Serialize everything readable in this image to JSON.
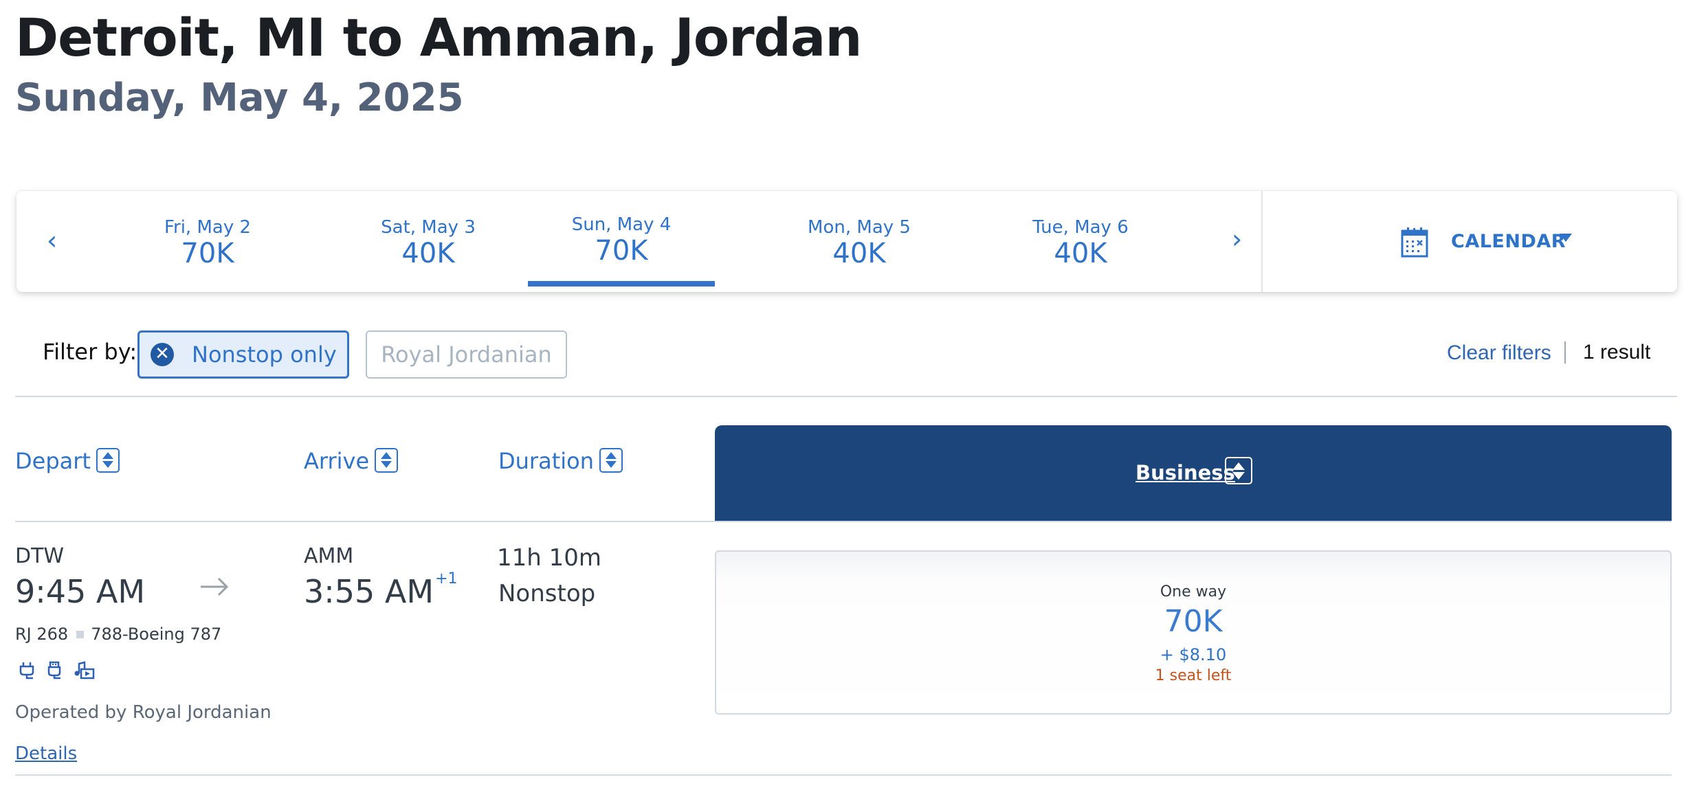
{
  "header": {
    "title": "Detroit, MI to Amman, Jordan",
    "date": "Sunday, May 4, 2025"
  },
  "date_strip": {
    "prev_icon": "chevron-left-icon",
    "next_icon": "chevron-right-icon",
    "dates": [
      {
        "label": "Fri, May 2",
        "price": "70K",
        "selected": false
      },
      {
        "label": "Sat, May 3",
        "price": "40K",
        "selected": false
      },
      {
        "label": "Sun, May 4",
        "price": "70K",
        "selected": true
      },
      {
        "label": "Mon, May 5",
        "price": "40K",
        "selected": false
      },
      {
        "label": "Tue, May 6",
        "price": "40K",
        "selected": false
      }
    ],
    "calendar_label": "CALENDAR",
    "calendar_icon": "calendar-icon",
    "accent_color": "#3374c8"
  },
  "filters": {
    "label": "Filter by:",
    "chips": [
      {
        "label": "Nonstop only",
        "active": true
      },
      {
        "label": "Royal Jordanian",
        "active": false
      }
    ],
    "clear_label": "Clear filters",
    "result_count": "1 result"
  },
  "columns": {
    "depart": "Depart",
    "arrive": "Arrive",
    "duration": "Duration",
    "cabin": "Business",
    "cabin_header_color": "#1c467b"
  },
  "flight": {
    "origin": "DTW",
    "depart_time": "9:45 AM",
    "destination": "AMM",
    "arrive_time": "3:55 AM",
    "day_offset": "+1",
    "flight_number": "RJ 268",
    "aircraft": "788-Boeing 787",
    "amenities": [
      "power-outlet-icon",
      "usb-icon",
      "entertainment-icon"
    ],
    "operated_by": "Operated by Royal Jordanian",
    "details_label": "Details",
    "duration": "11h 10m",
    "stops": "Nonstop",
    "fare": {
      "type": "One way",
      "miles": "70K",
      "taxes": "+ $8.10",
      "seats_left": "1 seat left"
    }
  }
}
